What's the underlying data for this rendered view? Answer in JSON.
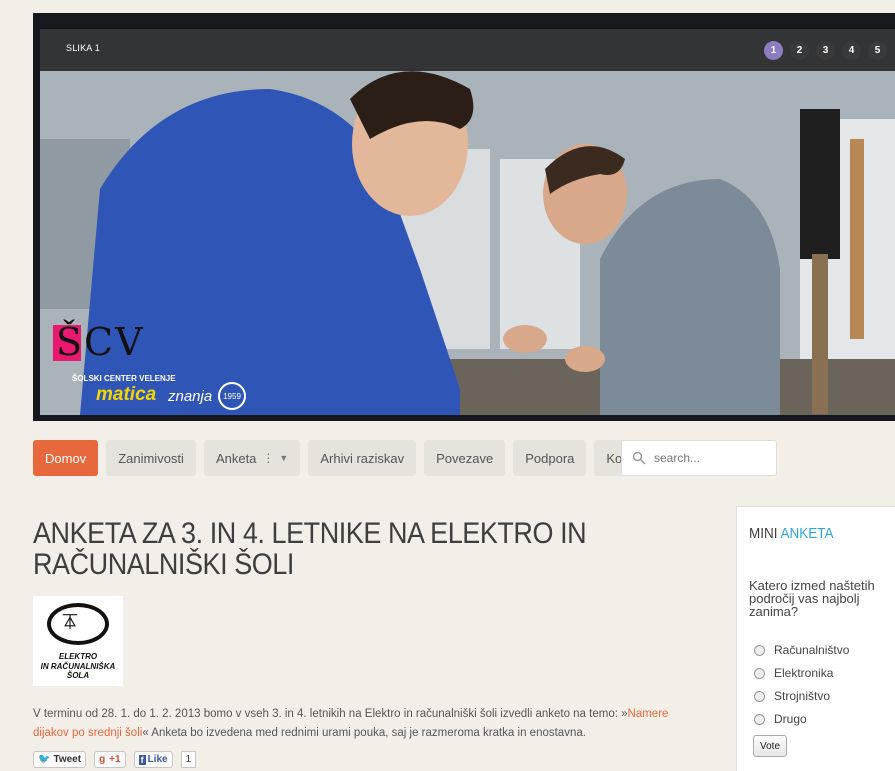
{
  "slider": {
    "caption": "SLIKA 1",
    "pages": [
      "1",
      "2",
      "3",
      "4",
      "5"
    ],
    "active_page": "1",
    "logo": {
      "letters": "ŠCV",
      "line1": "ŠOLSKI CENTER VELENJE",
      "line2": "matica",
      "line3": "znanja",
      "year": "1959"
    }
  },
  "nav": {
    "items": [
      "Domov",
      "Zanimivosti",
      "Anketa",
      "Arhivi raziskav",
      "Povezave",
      "Podpora",
      "Kontakt"
    ],
    "active": "Domov",
    "search_placeholder": "search..."
  },
  "article": {
    "title": "ANKETA ZA 3. IN 4. LETNIKE NA ELEKTRO IN RAČUNALNIŠKI ŠOLI",
    "logo_line1": "ELEKTRO",
    "logo_line2": "IN RAČUNALNIŠKA ŠOLA",
    "text_before": "V terminu od 28. 1. do 1. 2. 2013 bomo v vseh 3. in 4. letnikih na Elektro in računalniški šoli izvedli anketo na temo: »",
    "link_text": "Namere dijakov po srednji šoli",
    "text_after": "« Anketa bo izvedena med rednimi urami pouka, saj je razmeroma kratka in enostavna.",
    "social": {
      "tweet": "Tweet",
      "plus": "+1",
      "like": "Like",
      "like_count": "1"
    }
  },
  "poll": {
    "title_plain": "MINI",
    "title_accent": "ANKETA",
    "question": "Katero izmed naštetih področij vas najbolj zanima?",
    "options": [
      "Računalništvo",
      "Elektronika",
      "Strojništvo",
      "Drugo"
    ],
    "vote_label": "Vote"
  },
  "colors": {
    "accent": "#e8683d",
    "link": "#2aa7d8",
    "active_dot": "#8e7cc3"
  }
}
